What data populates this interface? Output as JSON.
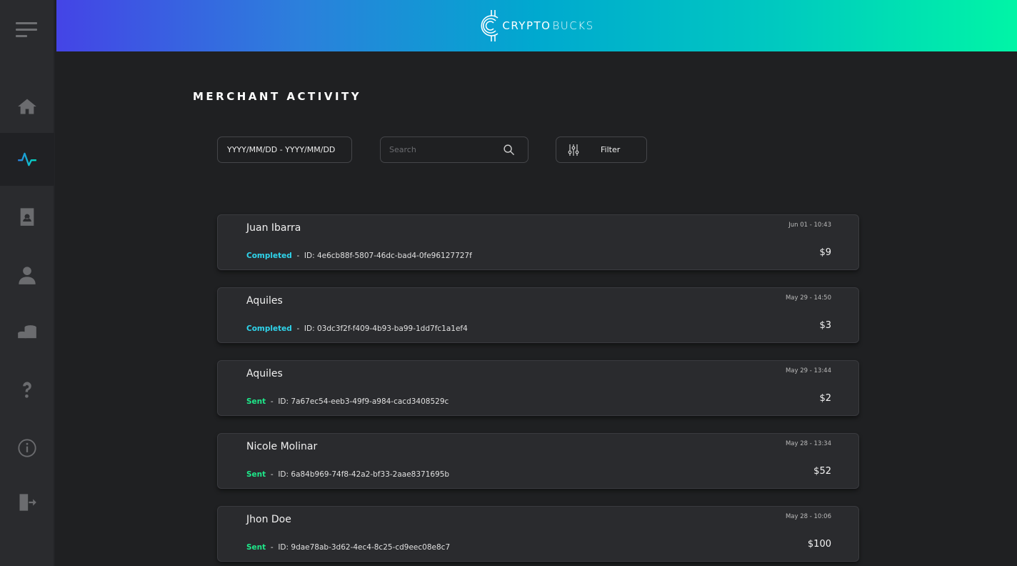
{
  "app": {
    "logo_text_a": "CRYPTO",
    "logo_text_b": "BUCKS"
  },
  "sidebar": {
    "items": [
      {
        "icon": "home-icon",
        "label": "home"
      },
      {
        "icon": "activity-icon",
        "label": "activity",
        "active": true
      },
      {
        "icon": "contacts-icon",
        "label": "contacts"
      },
      {
        "icon": "user-icon",
        "label": "profile"
      },
      {
        "icon": "coins-icon",
        "label": "coins"
      },
      {
        "icon": "help-icon",
        "label": "help"
      },
      {
        "icon": "info-icon",
        "label": "info"
      },
      {
        "icon": "logout-icon",
        "label": "logout"
      }
    ]
  },
  "page": {
    "title": "MERCHANT ACTIVITY"
  },
  "controls": {
    "date_range": "YYYY/MM/DD - YYYY/MM/DD",
    "search_placeholder": "Search",
    "filter_label": "Filter"
  },
  "colors": {
    "completed": "#2fd5ec",
    "sent": "#1ee88a",
    "accent": "#00c9c0"
  },
  "transactions": [
    {
      "name": "Juan Ibarra",
      "status": "Completed",
      "id": "ID: 4e6cb88f-5807-46dc-bad4-0fe96127727f",
      "date": "Jun 01 - 10:43",
      "amount": "$9"
    },
    {
      "name": "Aquiles",
      "status": "Completed",
      "id": "ID: 03dc3f2f-f409-4b93-ba99-1dd7fc1a1ef4",
      "date": "May 29 - 14:50",
      "amount": "$3"
    },
    {
      "name": "Aquiles",
      "status": "Sent",
      "id": "ID: 7a67ec54-eeb3-49f9-a984-cacd3408529c",
      "date": "May 29 - 13:44",
      "amount": "$2"
    },
    {
      "name": "Nicole Molinar",
      "status": "Sent",
      "id": "ID: 6a84b969-74f8-42a2-bf33-2aae8371695b",
      "date": "May 28 - 13:34",
      "amount": "$52"
    },
    {
      "name": "Jhon Doe",
      "status": "Sent",
      "id": "ID: 9dae78ab-3d62-4ec4-8c25-cd9eec08e8c7",
      "date": "May 28 - 10:06",
      "amount": "$100"
    }
  ]
}
